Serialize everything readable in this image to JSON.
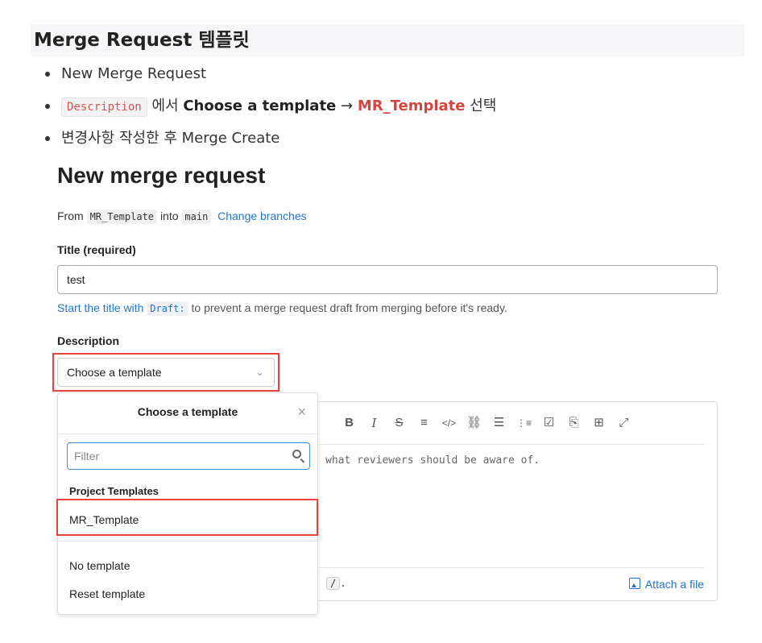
{
  "heading": "Merge Request 템플릿",
  "bullets": {
    "item1": "New Merge Request",
    "item2": {
      "code": "Description",
      "text1": "에서",
      "bold1": "Choose a template",
      "arrow": "→",
      "bold2": "MR_Template",
      "text2": "선택"
    },
    "item3": "변경사항 작성한 후 Merge Create"
  },
  "screenshot": {
    "page_title": "New merge request",
    "from_line": {
      "from": "From",
      "source_branch": "MR_Template",
      "into": "into",
      "target_branch": "main",
      "change_branches": "Change branches"
    },
    "title_label": "Title (required)",
    "title_value": "test",
    "hint": {
      "link": "Start the title with",
      "code": "Draft:",
      "rest": "to prevent a merge request draft from merging before it's ready."
    },
    "description_label": "Description",
    "template_select": {
      "value": "Choose a template",
      "chevron": "⌄"
    },
    "editor": {
      "toolbar": [
        "B",
        "I",
        "S",
        "≡",
        "</>",
        "⛓",
        "☰",
        "⋮≡",
        "☑",
        "⎘",
        "⊞",
        "⤢"
      ],
      "placeholder": "what reviewers should be aware of.",
      "slash_prefix": "/",
      "slash_suffix": ".",
      "attach_label": "Attach a file"
    },
    "dropdown": {
      "header": "Choose a template",
      "close": "×",
      "filter_placeholder": "Filter",
      "section": "Project Templates",
      "items": [
        "MR_Template"
      ],
      "footer_items": [
        "No template",
        "Reset template"
      ]
    }
  },
  "colors": {
    "highlight_border": "#e4443a",
    "link": "#1f75cb",
    "accent_red": "#d0473f"
  }
}
